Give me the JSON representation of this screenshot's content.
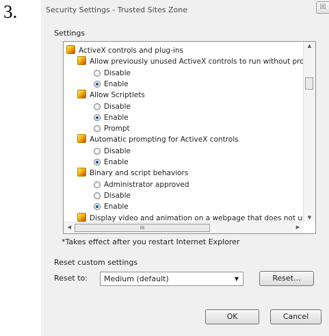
{
  "step_number": "3.",
  "dialog": {
    "title": "Security Settings - Trusted Sites Zone",
    "close_glyph": "☒",
    "settings_label": "Settings",
    "list": {
      "items": [
        {
          "type": "category",
          "label": "ActiveX controls and plug-ins"
        },
        {
          "type": "setting",
          "label": "Allow previously unused ActiveX controls to run without pron"
        },
        {
          "type": "option",
          "label": "Disable",
          "selected": false
        },
        {
          "type": "option",
          "label": "Enable",
          "selected": true
        },
        {
          "type": "setting",
          "label": "Allow Scriptlets"
        },
        {
          "type": "option",
          "label": "Disable",
          "selected": false
        },
        {
          "type": "option",
          "label": "Enable",
          "selected": true
        },
        {
          "type": "option",
          "label": "Prompt",
          "selected": false
        },
        {
          "type": "setting",
          "label": "Automatic prompting for ActiveX controls"
        },
        {
          "type": "option",
          "label": "Disable",
          "selected": false
        },
        {
          "type": "option",
          "label": "Enable",
          "selected": true
        },
        {
          "type": "setting",
          "label": "Binary and script behaviors"
        },
        {
          "type": "option",
          "label": "Administrator approved",
          "selected": false
        },
        {
          "type": "option",
          "label": "Disable",
          "selected": false
        },
        {
          "type": "option",
          "label": "Enable",
          "selected": true
        },
        {
          "type": "setting",
          "label": "Display video and animation on a webpage that does not use"
        }
      ],
      "hscroll_thumb_glyph": "III"
    },
    "footnote": "*Takes effect after you restart Internet Explorer",
    "reset_section_label": "Reset custom settings",
    "reset_to_label": "Reset to:",
    "reset_select_value": "Medium (default)",
    "reset_button_label": "Reset...",
    "ok_label": "OK",
    "cancel_label": "Cancel"
  },
  "colors": {
    "radio_dot": "#1d4f9c",
    "dialog_bg": "#f0f0f0",
    "border": "#8e8f8f"
  },
  "icons": {
    "setting": "shield-setting-icon",
    "radio": "radio-button",
    "close": "close-icon"
  }
}
